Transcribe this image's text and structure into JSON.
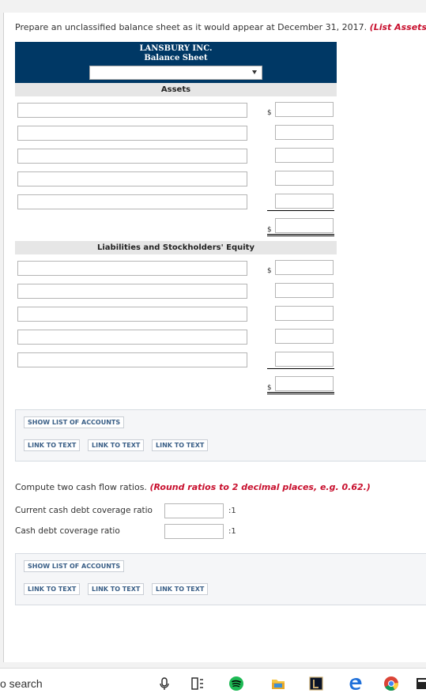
{
  "instruction": {
    "text": "Prepare an unclassified balance sheet as it would appear at December 31, 2017.",
    "note": "(List Assets i"
  },
  "balance_sheet": {
    "company": "LANSBURY INC.",
    "title": "Balance Sheet",
    "date_select_value": "",
    "assets_heading": "Assets",
    "liabilities_heading": "Liabilities and Stockholders' Equity",
    "dollar_sign": "$"
  },
  "buttons": {
    "show_list": "SHOW LIST OF ACCOUNTS",
    "link_to_text": "LINK TO TEXT"
  },
  "ratios": {
    "instruction": "Compute two cash flow ratios.",
    "note": "(Round ratios to 2 decimal places, e.g. 0.62.)",
    "current_label": "Current cash debt coverage ratio",
    "cash_label": "Cash debt coverage ratio",
    "suffix": ":1"
  },
  "taskbar": {
    "search_text": "o search",
    "icons": [
      "microphone-icon",
      "task-view-icon",
      "spotify-icon",
      "file-explorer-icon",
      "league-client-icon",
      "edge-icon",
      "chrome-icon",
      "app-icon"
    ]
  }
}
